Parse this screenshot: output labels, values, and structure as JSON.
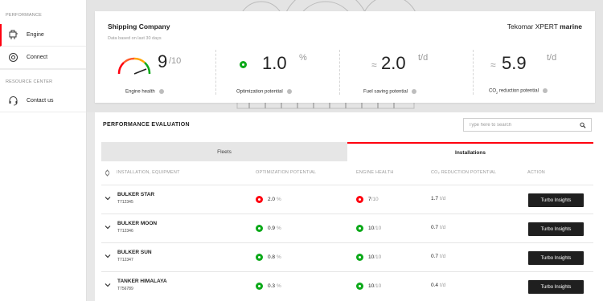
{
  "sidebar": {
    "section_performance": "PERFORMANCE",
    "section_resource": "RESOURCE CENTER",
    "items": [
      {
        "label": "Engine",
        "icon": "engine-icon",
        "active": true
      },
      {
        "label": "Connect",
        "icon": "connect-icon",
        "active": false
      },
      {
        "label": "Contact us",
        "icon": "headset-icon",
        "active": false
      }
    ]
  },
  "header": {
    "company": "Shipping Company",
    "data_note": "Data based on last 30 days",
    "brand_regular": "Tekomar XPERT ",
    "brand_bold": "marine"
  },
  "kpis": {
    "engine_health": {
      "value": "9",
      "max": "/10",
      "label": "Engine health"
    },
    "optimization": {
      "value": "1.0",
      "unit": "%",
      "label": "Optimization potential"
    },
    "fuel_saving": {
      "prefix": "≈",
      "value": "2.0",
      "unit": "t/d",
      "label": "Fuel saving potential"
    },
    "co2": {
      "prefix": "≈",
      "value": "5.9",
      "unit": "t/d",
      "label_pre": "CO",
      "label_sub": "2",
      "label_post": " reduction potential"
    }
  },
  "evaluation": {
    "title": "PERFORMANCE EVALUATION",
    "search_placeholder": "Type here to search",
    "tabs": [
      {
        "label": "Fleets",
        "active": false
      },
      {
        "label": "Installations",
        "active": true
      }
    ],
    "columns": {
      "installation": "INSTALLATION, EQUIPMENT",
      "optimization": "OPTIMIZATION POTENTIAL",
      "health": "ENGINE HEALTH",
      "co2": "CO₂ REDUCTION POTENTIAL",
      "action": "ACTION"
    },
    "rows": [
      {
        "name": "BULKER STAR",
        "code": "T712345",
        "opt_value": "2.0",
        "opt_unit": "%",
        "opt_status": "red",
        "health_value": "7",
        "health_max": "/10",
        "health_status": "red",
        "co2_value": "1.7",
        "co2_unit": "t/d",
        "action": "Turbo Insights"
      },
      {
        "name": "BULKER MOON",
        "code": "T712346",
        "opt_value": "0.9",
        "opt_unit": "%",
        "opt_status": "green",
        "health_value": "10",
        "health_max": "/10",
        "health_status": "green",
        "co2_value": "0.7",
        "co2_unit": "t/d",
        "action": "Turbo Insights"
      },
      {
        "name": "BULKER SUN",
        "code": "T712347",
        "opt_value": "0.8",
        "opt_unit": "%",
        "opt_status": "green",
        "health_value": "10",
        "health_max": "/10",
        "health_status": "green",
        "co2_value": "0.7",
        "co2_unit": "t/d",
        "action": "Turbo Insights"
      },
      {
        "name": "TANKER HIMALAYA",
        "code": "T756789",
        "opt_value": "0.3",
        "opt_unit": "%",
        "opt_status": "green",
        "health_value": "10",
        "health_max": "/10",
        "health_status": "green",
        "co2_value": "0.4",
        "co2_unit": "t/d",
        "action": "Turbo Insights"
      }
    ]
  },
  "colors": {
    "accent": "#ff000f",
    "ok": "#0ca919",
    "dark": "#1f1f1f"
  }
}
